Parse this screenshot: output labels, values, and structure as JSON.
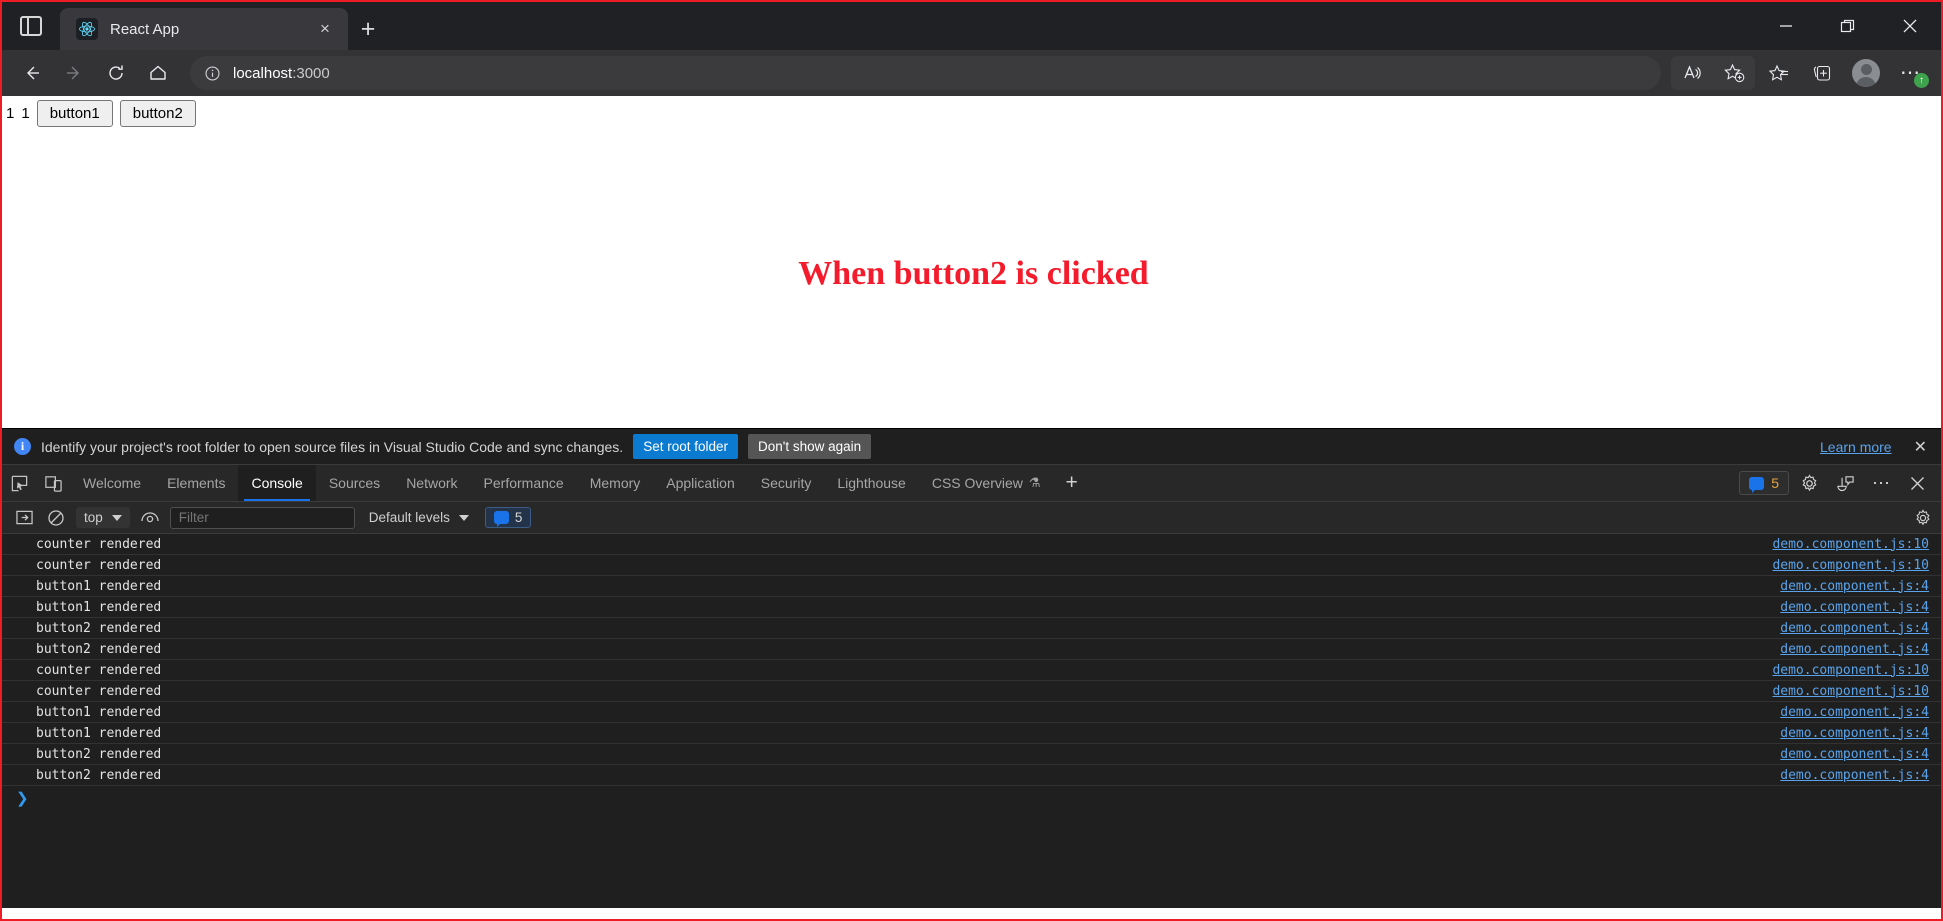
{
  "browser": {
    "tab": {
      "title": "React App",
      "favicon": "react-atom-icon",
      "close": "×"
    },
    "new_tab_label": "+",
    "window_controls": {
      "minimize": "–",
      "maximize": "❐",
      "close": "✕"
    },
    "toolbar": {
      "back": "←",
      "forward": "→",
      "reload": "⟳",
      "home": "⌂",
      "url_host": "localhost",
      "url_port": ":3000",
      "site_info": "i",
      "read_aloud": "read-aloud-icon",
      "add_favorite": "add-favorite-icon",
      "favorites": "favorites-icon",
      "collections": "collections-icon",
      "profile": "profile-avatar",
      "settings_more": "⋯",
      "update_badge": "↑"
    }
  },
  "page": {
    "counter_values": [
      "1",
      "1"
    ],
    "buttons": [
      {
        "label": "button1"
      },
      {
        "label": "button2"
      }
    ],
    "headline": "When button2 is clicked",
    "headline_color": "#f41c2c"
  },
  "devtools": {
    "notice": {
      "icon": "info-icon",
      "text": "Identify your project's root folder to open source files in Visual Studio Code and sync changes.",
      "primary_button": "Set root folder",
      "secondary_button": "Don't show again",
      "learn_more": "Learn more",
      "close": "✕"
    },
    "tabs": [
      {
        "label": "Welcome",
        "active": false
      },
      {
        "label": "Elements",
        "active": false
      },
      {
        "label": "Console",
        "active": true
      },
      {
        "label": "Sources",
        "active": false
      },
      {
        "label": "Network",
        "active": false
      },
      {
        "label": "Performance",
        "active": false
      },
      {
        "label": "Memory",
        "active": false
      },
      {
        "label": "Application",
        "active": false
      },
      {
        "label": "Security",
        "active": false
      },
      {
        "label": "Lighthouse",
        "active": false
      },
      {
        "label": "CSS Overview",
        "active": false,
        "badge": "⚗"
      }
    ],
    "add_tab": "+",
    "message_badge_count": "5",
    "tools": {
      "inspect": "inspect-element-icon",
      "device": "device-toolbar-icon",
      "settings": "gear-icon",
      "feedback": "feedback-icon",
      "more": "⋯",
      "close": "✕"
    },
    "console_toolbar": {
      "sidebar_toggle": "console-sidebar-icon",
      "clear": "clear-console-icon",
      "context": "top",
      "eye": "live-expression-icon",
      "filter_placeholder": "Filter",
      "filter_value": "",
      "levels": "Default levels",
      "level_count": "5",
      "settings": "gear-icon"
    },
    "logs": [
      {
        "text": "counter rendered",
        "source": "demo.component.js:10"
      },
      {
        "text": "counter rendered",
        "source": "demo.component.js:10"
      },
      {
        "text": "button1 rendered",
        "source": "demo.component.js:4"
      },
      {
        "text": "button1 rendered",
        "source": "demo.component.js:4"
      },
      {
        "text": "button2 rendered",
        "source": "demo.component.js:4"
      },
      {
        "text": "button2 rendered",
        "source": "demo.component.js:4"
      },
      {
        "text": "counter rendered",
        "source": "demo.component.js:10"
      },
      {
        "text": "counter rendered",
        "source": "demo.component.js:10"
      },
      {
        "text": "button1 rendered",
        "source": "demo.component.js:4"
      },
      {
        "text": "button1 rendered",
        "source": "demo.component.js:4"
      },
      {
        "text": "button2 rendered",
        "source": "demo.component.js:4"
      },
      {
        "text": "button2 rendered",
        "source": "demo.component.js:4"
      }
    ],
    "prompt": "❯"
  }
}
